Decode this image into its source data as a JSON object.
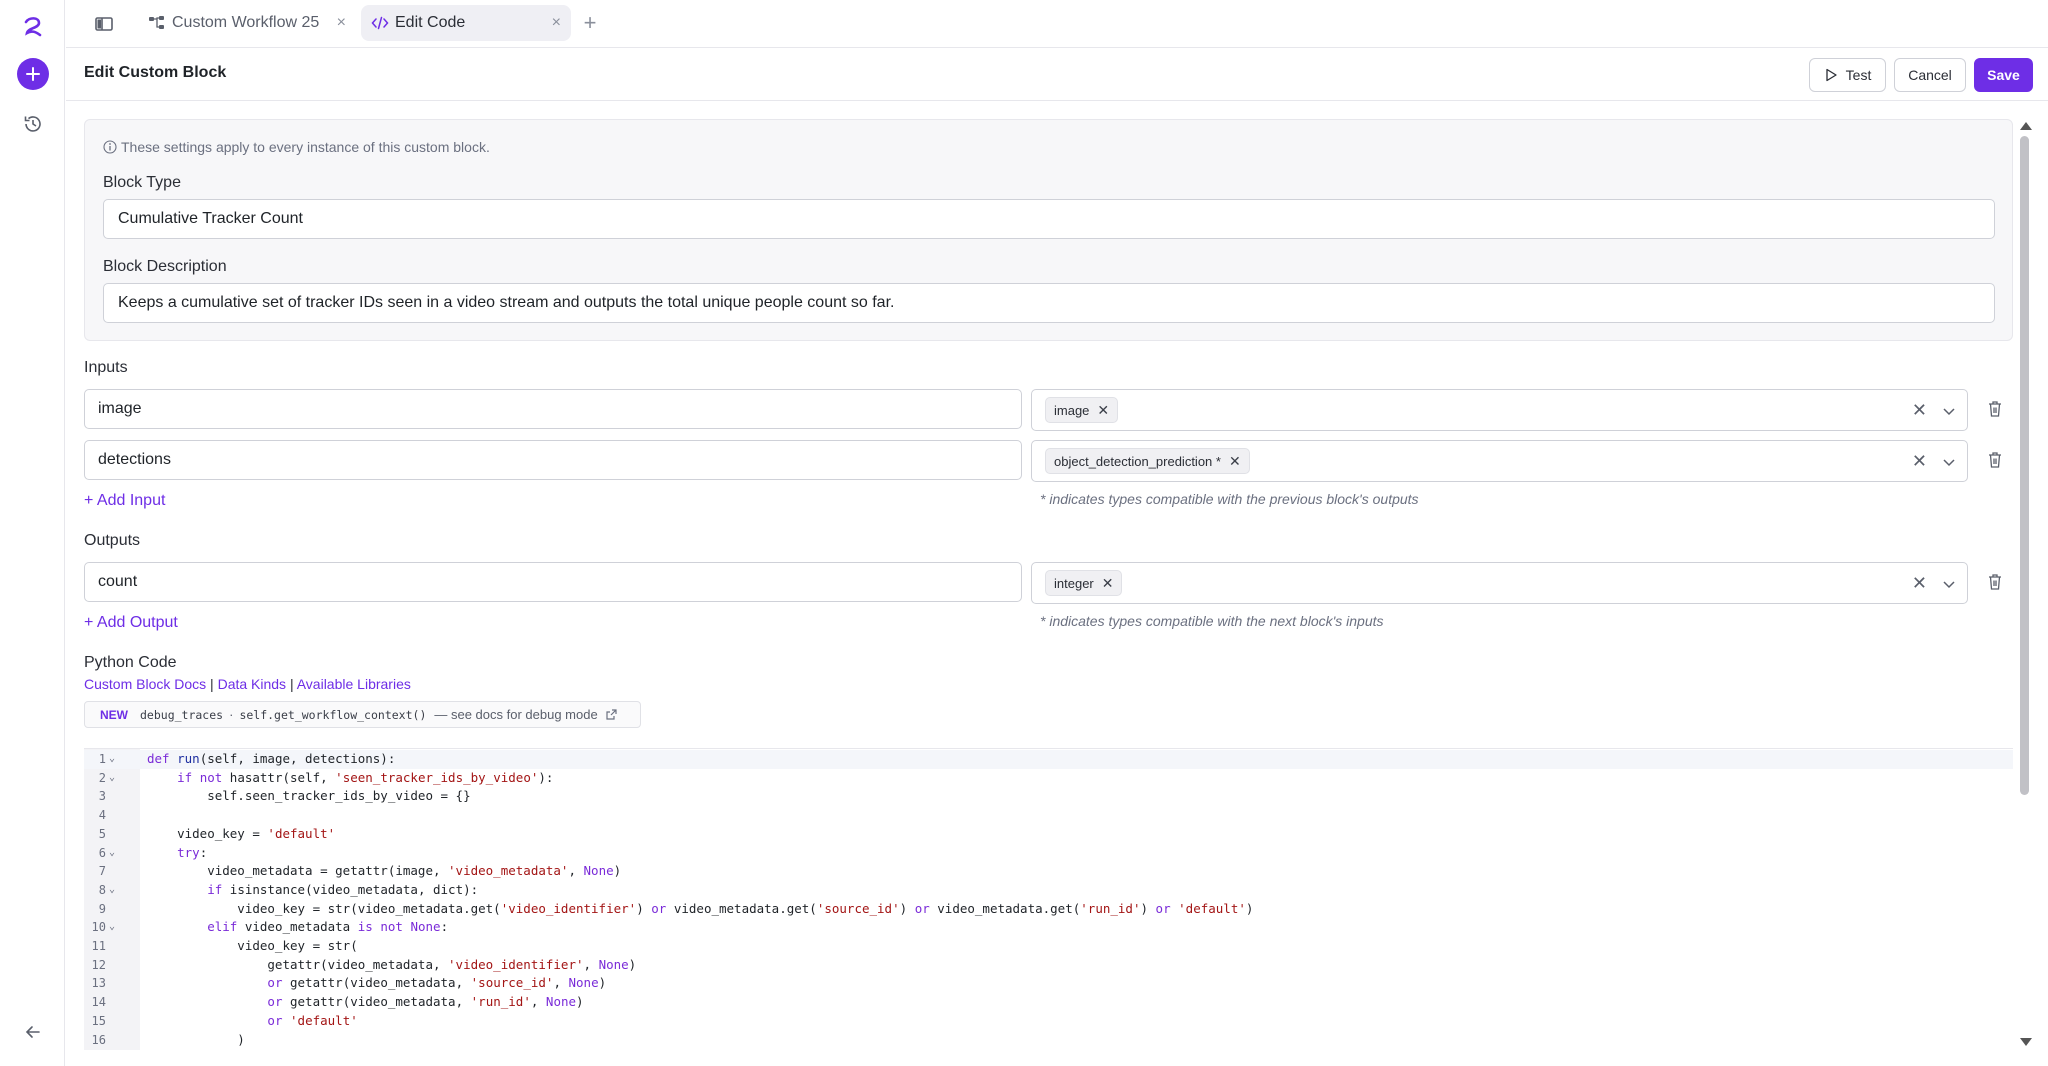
{
  "colors": {
    "accent": "#6e2ee6",
    "border": "#cfd1d8",
    "muted": "#6b7080"
  },
  "tabs": [
    {
      "label": "Custom Workflow 25",
      "icon": "workflow-icon",
      "close": "×"
    },
    {
      "label": "Edit Code",
      "icon": "code-icon",
      "close": "×",
      "active": true
    }
  ],
  "tab_add": "+",
  "header": {
    "title": "Edit Custom Block",
    "test_label": "Test",
    "cancel_label": "Cancel",
    "save_label": "Save"
  },
  "settings": {
    "note": "These settings apply to every instance of this custom block.",
    "block_type_label": "Block Type",
    "block_type_value": "Cumulative Tracker Count",
    "block_description_label": "Block Description",
    "block_description_value": "Keeps a cumulative set of tracker IDs seen in a video stream and outputs the total unique people count so far."
  },
  "inputs": {
    "label": "Inputs",
    "rows": [
      {
        "name": "image",
        "type": "image"
      },
      {
        "name": "detections",
        "type": "object_detection_prediction *"
      }
    ],
    "add_label": "+ Add Input",
    "hint": "* indicates types compatible with the previous block's outputs"
  },
  "outputs": {
    "label": "Outputs",
    "rows": [
      {
        "name": "count",
        "type": "integer"
      }
    ],
    "add_label": "+ Add Output",
    "hint": "* indicates types compatible with the next block's inputs"
  },
  "python": {
    "label": "Python Code",
    "links": [
      "Custom Block Docs",
      "Data Kinds",
      "Available Libraries"
    ],
    "link_sep": "|",
    "banner_new": "NEW",
    "banner_code1": "debug_traces",
    "banner_sep": "·",
    "banner_code2": "self.get_workflow_context()",
    "banner_text": "— see docs for debug mode"
  },
  "code_lines": [
    {
      "n": "1",
      "fold": true,
      "text": "def run(self, image, detections):"
    },
    {
      "n": "2",
      "fold": true,
      "text": "    if not hasattr(self, 'seen_tracker_ids_by_video'):"
    },
    {
      "n": "3",
      "fold": false,
      "text": "        self.seen_tracker_ids_by_video = {}"
    },
    {
      "n": "4",
      "fold": false,
      "text": ""
    },
    {
      "n": "5",
      "fold": false,
      "text": "    video_key = 'default'"
    },
    {
      "n": "6",
      "fold": true,
      "text": "    try:"
    },
    {
      "n": "7",
      "fold": false,
      "text": "        video_metadata = getattr(image, 'video_metadata', None)"
    },
    {
      "n": "8",
      "fold": true,
      "text": "        if isinstance(video_metadata, dict):"
    },
    {
      "n": "9",
      "fold": false,
      "text": "            video_key = str(video_metadata.get('video_identifier') or video_metadata.get('source_id') or video_metadata.get('run_id') or 'default')"
    },
    {
      "n": "10",
      "fold": true,
      "text": "        elif video_metadata is not None:"
    },
    {
      "n": "11",
      "fold": false,
      "text": "            video_key = str("
    },
    {
      "n": "12",
      "fold": false,
      "text": "                getattr(video_metadata, 'video_identifier', None)"
    },
    {
      "n": "13",
      "fold": false,
      "text": "                or getattr(video_metadata, 'source_id', None)"
    },
    {
      "n": "14",
      "fold": false,
      "text": "                or getattr(video_metadata, 'run_id', None)"
    },
    {
      "n": "15",
      "fold": false,
      "text": "                or 'default'"
    },
    {
      "n": "16",
      "fold": false,
      "text": "            )"
    }
  ]
}
